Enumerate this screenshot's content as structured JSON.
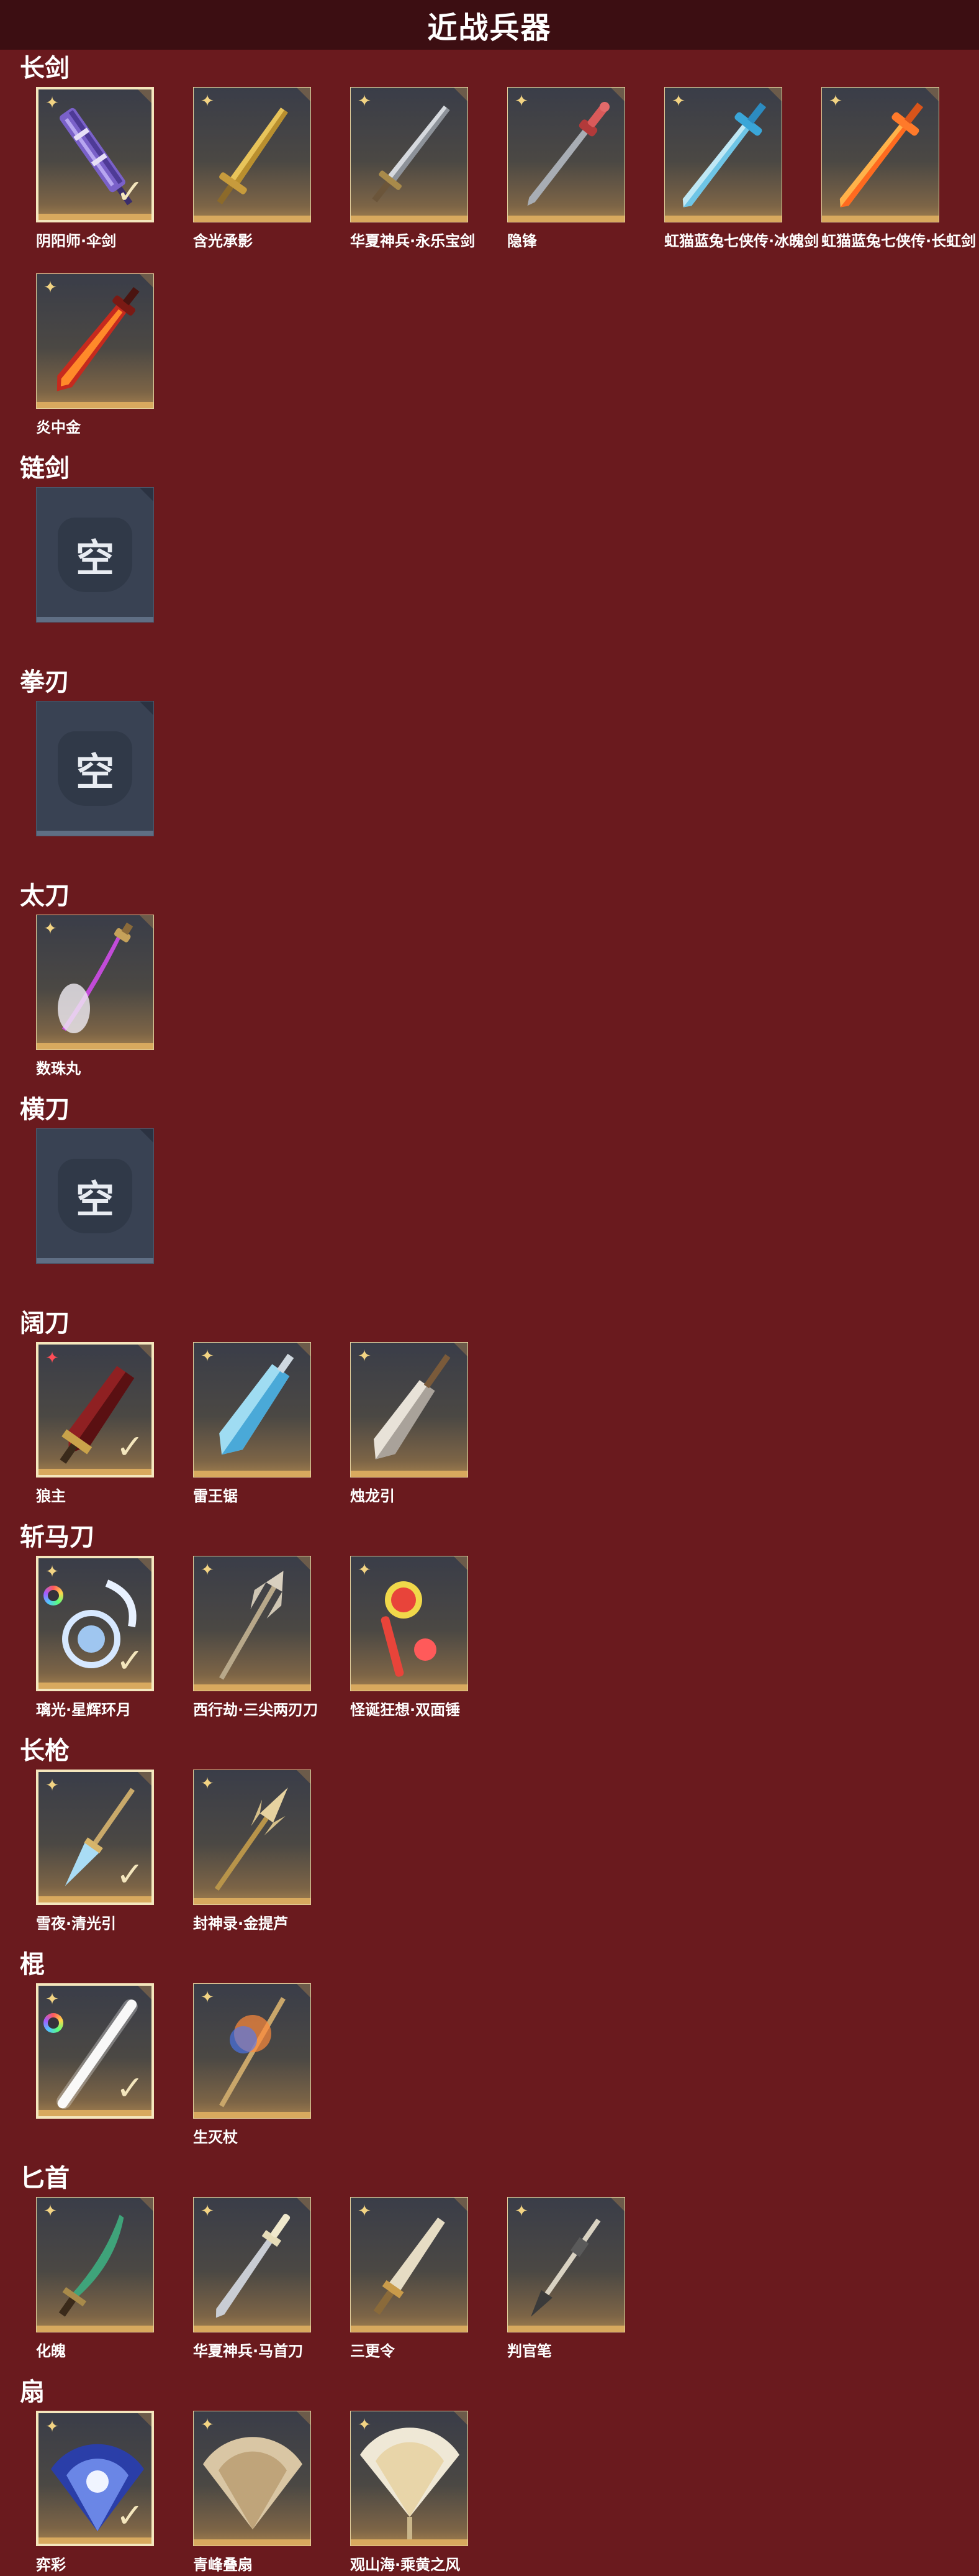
{
  "header": {
    "title": "近战兵器"
  },
  "sections": [
    {
      "title": "长剑",
      "items": [
        {
          "name": "阴阳师·伞剑",
          "selected": true,
          "rarity": "gold",
          "art": "umbrella"
        },
        {
          "name": "含光承影",
          "selected": false,
          "rarity": "gold",
          "art": "gold-sword"
        },
        {
          "name": "华夏神兵·永乐宝剑",
          "selected": false,
          "rarity": "gold",
          "art": "silver-sword"
        },
        {
          "name": "隐锋",
          "selected": false,
          "rarity": "gold",
          "art": "red-hilt-sword"
        },
        {
          "name": "虹猫蓝兔七侠传·冰魄剑",
          "selected": false,
          "rarity": "gold",
          "art": "ice-sword"
        },
        {
          "name": "虹猫蓝兔七侠传·长虹剑",
          "selected": false,
          "rarity": "gold",
          "art": "fire-sword"
        },
        {
          "name": "炎中金",
          "selected": false,
          "rarity": "gold",
          "art": "flame-sword"
        }
      ]
    },
    {
      "title": "链剑",
      "empty": true,
      "empty_label": "空"
    },
    {
      "title": "拳刃",
      "empty": true,
      "empty_label": "空"
    },
    {
      "title": "太刀",
      "items": [
        {
          "name": "数珠丸",
          "selected": false,
          "rarity": "gold",
          "art": "katana"
        }
      ]
    },
    {
      "title": "横刀",
      "empty": true,
      "empty_label": "空"
    },
    {
      "title": "阔刀",
      "items": [
        {
          "name": "狼主",
          "selected": true,
          "rarity": "red",
          "art": "broadblade-red"
        },
        {
          "name": "雷王锯",
          "selected": false,
          "rarity": "gold",
          "art": "broadblade-ice"
        },
        {
          "name": "烛龙引",
          "selected": false,
          "rarity": "gold",
          "art": "broadblade-white"
        }
      ]
    },
    {
      "title": "斩马刀",
      "items": [
        {
          "name": "璃光·星辉环月",
          "selected": true,
          "rarity": "gold",
          "ring": true,
          "art": "moon-blade"
        },
        {
          "name": "西行劫·三尖两刃刀",
          "selected": false,
          "rarity": "gold",
          "art": "trident"
        },
        {
          "name": "怪诞狂想·双面锤",
          "selected": false,
          "rarity": "gold",
          "art": "hammer"
        }
      ]
    },
    {
      "title": "长枪",
      "items": [
        {
          "name": "雪夜·清光引",
          "selected": true,
          "rarity": "gold",
          "art": "spear-ice"
        },
        {
          "name": "封神录·金提芦",
          "selected": false,
          "rarity": "gold",
          "art": "spear-gold"
        }
      ]
    },
    {
      "title": "棍",
      "items": [
        {
          "name": "",
          "selected": true,
          "rarity": "gold",
          "ring": true,
          "art": "staff-light"
        },
        {
          "name": "生灭杖",
          "selected": false,
          "rarity": "gold",
          "art": "staff-fire"
        }
      ]
    },
    {
      "title": "匕首",
      "items": [
        {
          "name": "化魄",
          "selected": false,
          "rarity": "gold",
          "art": "dagger-green"
        },
        {
          "name": "华夏神兵·马首刀",
          "selected": false,
          "rarity": "gold",
          "art": "dagger-silver"
        },
        {
          "name": "三更令",
          "selected": false,
          "rarity": "gold",
          "art": "dagger-gold"
        },
        {
          "name": "判官笔",
          "selected": false,
          "rarity": "gold",
          "art": "brush"
        }
      ]
    },
    {
      "title": "扇",
      "items": [
        {
          "name": "弈彩",
          "selected": true,
          "rarity": "gold",
          "art": "fan-blue"
        },
        {
          "name": "青峰叠扇",
          "selected": false,
          "rarity": "gold",
          "art": "fan-tan"
        },
        {
          "name": "观山海·乘黄之风",
          "selected": false,
          "rarity": "gold",
          "art": "fan-white"
        }
      ]
    }
  ],
  "colors": {
    "background": "#6a1a1e",
    "header": "#3c0e12",
    "tile_border_selected": "#f4e6bd",
    "rarity_gold": "#f3d483",
    "rarity_red": "#ff4d57"
  }
}
